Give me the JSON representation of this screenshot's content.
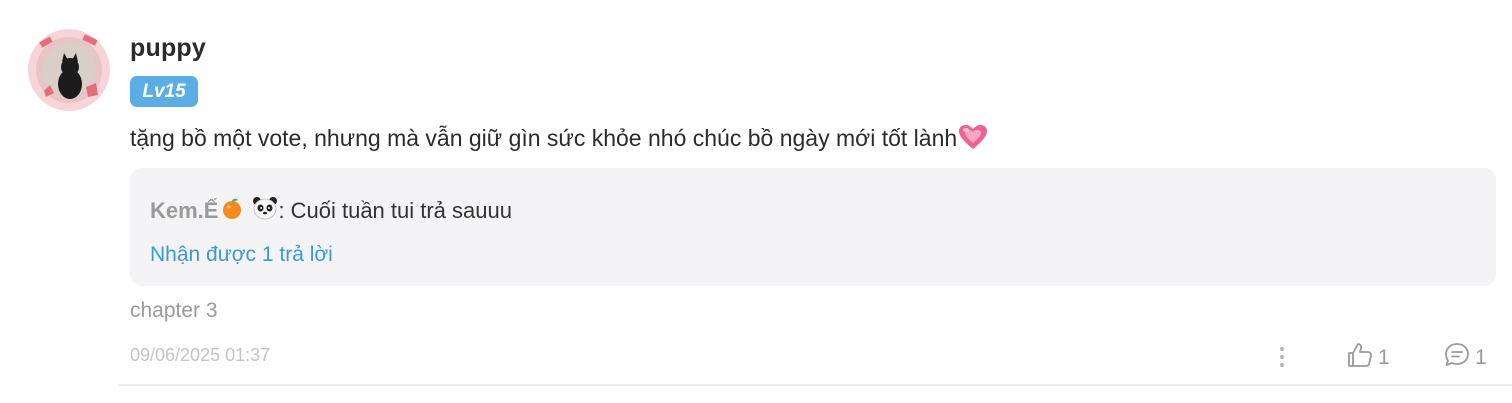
{
  "comment": {
    "username": "puppy",
    "level": "Lv15",
    "text": "tặng bồ một vote, nhưng mà vẫn giữ gìn sức khỏe nhó chúc bồ ngày mới tốt lành",
    "text_emoji": "growing-heart-icon",
    "chapter": "chapter 3",
    "timestamp": "09/06/2025 01:37",
    "like_count": "1",
    "reply_total": "1"
  },
  "reply": {
    "author": "Kem.Ế",
    "author_emojis": [
      "tangerine-icon",
      "panda-icon"
    ],
    "separator": ":",
    "text": "Cuối tuần tui trả sauuu",
    "reply_count_label": "Nhận được 1 trả lời"
  },
  "colors": {
    "level_badge": "#5aaee3",
    "link": "#3a9ad9",
    "reply_bg": "#f4f4f6",
    "muted": "#9a9a9a"
  }
}
